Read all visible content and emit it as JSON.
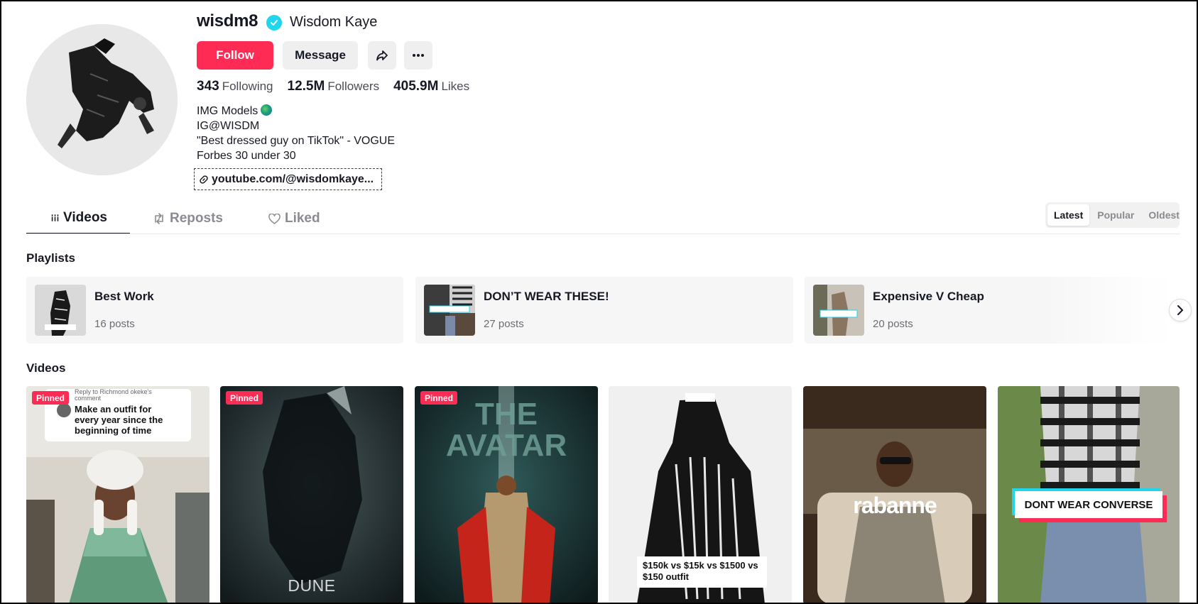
{
  "profile": {
    "username": "wisdm8",
    "nickname": "Wisdom Kaye",
    "follow_label": "Follow",
    "message_label": "Message",
    "stats": [
      {
        "value": "343",
        "label": "Following"
      },
      {
        "value": "12.5M",
        "label": "Followers"
      },
      {
        "value": "405.9M",
        "label": "Likes"
      }
    ],
    "bio": [
      "IMG Models",
      "IG@WISDM",
      "\"Best dressed guy on TikTok\" - VOGUE",
      "Forbes 30 under 30"
    ],
    "link": "youtube.com/@wisdomkaye..."
  },
  "tabs": [
    {
      "label": "Videos",
      "icon": "grid-icon",
      "active": true
    },
    {
      "label": "Reposts",
      "icon": "repost-icon",
      "active": false
    },
    {
      "label": "Liked",
      "icon": "heart-icon",
      "active": false
    }
  ],
  "sort": {
    "options": [
      "Latest",
      "Popular",
      "Oldest"
    ],
    "selected": "Latest"
  },
  "playlists_title": "Playlists",
  "playlists": [
    {
      "name": "Best Work",
      "count": "16 posts"
    },
    {
      "name": "DON’T WEAR THESE!",
      "count": "27 posts"
    },
    {
      "name": "Expensive V Cheap",
      "count": "20 posts"
    }
  ],
  "videos_title": "Videos",
  "videos": [
    {
      "pinned": "Pinned",
      "reply_meta": "Reply to Richmond okeke's comment",
      "reply_text": "Make an outfit for every year since the beginning of time"
    },
    {
      "pinned": "Pinned",
      "caption": "DUNE"
    },
    {
      "pinned": "Pinned",
      "caption": "THE AVATAR"
    },
    {
      "caption": "$150k vs $15k vs $1500 vs $150 outfit"
    },
    {
      "caption": "rabanne"
    },
    {
      "caption": "DONT WEAR CONVERSE"
    }
  ],
  "colors": {
    "brand": "#fe2c55",
    "verified": "#20d5ec",
    "text": "#161823",
    "muted": "#8a8b91"
  }
}
